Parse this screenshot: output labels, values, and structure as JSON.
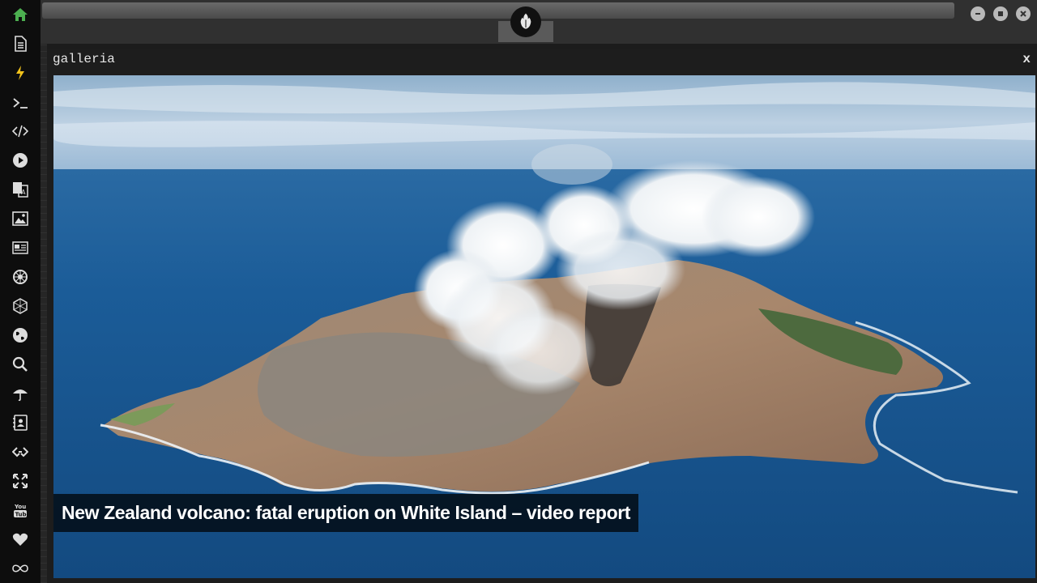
{
  "sidebar": {
    "icons": [
      "home-icon",
      "document-icon",
      "lightning-icon",
      "terminal-icon",
      "code-icon",
      "play-icon",
      "translate-icon",
      "image-icon",
      "news-icon",
      "settings-gear-icon",
      "hexagon-icon",
      "globe-icon",
      "search-icon",
      "umbrella-icon",
      "contact-card-icon",
      "chain-link-icon",
      "fullscreen-icon",
      "youtube-icon",
      "heart-icon",
      "infinity-icon"
    ],
    "active_color": "#4caf50"
  },
  "window": {
    "title": "galleria",
    "close_label": "x"
  },
  "gallery": {
    "caption": "New Zealand volcano: fatal eruption on White Island – video report"
  },
  "youtube_label": "You\nTube"
}
